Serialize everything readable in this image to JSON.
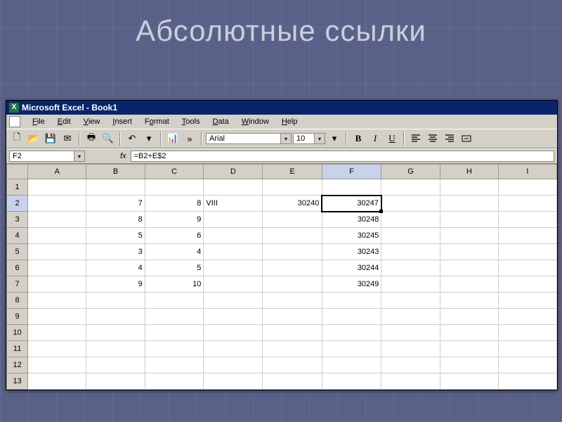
{
  "slide": {
    "title": "Абсолютные ссылки"
  },
  "window": {
    "title": "Microsoft Excel - Book1"
  },
  "menubar": {
    "items": [
      "File",
      "Edit",
      "View",
      "Insert",
      "Format",
      "Tools",
      "Data",
      "Window",
      "Help"
    ]
  },
  "toolbar": {
    "font_name": "Arial",
    "font_size": "10",
    "bold": "B",
    "italic": "I",
    "underline": "U"
  },
  "formula_bar": {
    "name_box": "F2",
    "fx_label": "fx",
    "formula": "=B2+E$2"
  },
  "sheet": {
    "columns": [
      "A",
      "B",
      "C",
      "D",
      "E",
      "F",
      "G",
      "H",
      "I"
    ],
    "active_col": "F",
    "active_row": "2",
    "rows": [
      {
        "num": "1",
        "cells": {
          "B": "",
          "C": "",
          "D": "",
          "E": "",
          "F": ""
        }
      },
      {
        "num": "2",
        "cells": {
          "B": "7",
          "C": "8",
          "D": "VIII",
          "E": "30240",
          "F": "30247"
        }
      },
      {
        "num": "3",
        "cells": {
          "B": "8",
          "C": "9",
          "D": "",
          "E": "",
          "F": "30248"
        }
      },
      {
        "num": "4",
        "cells": {
          "B": "5",
          "C": "6",
          "D": "",
          "E": "",
          "F": "30245"
        }
      },
      {
        "num": "5",
        "cells": {
          "B": "3",
          "C": "4",
          "D": "",
          "E": "",
          "F": "30243"
        }
      },
      {
        "num": "6",
        "cells": {
          "B": "4",
          "C": "5",
          "D": "",
          "E": "",
          "F": "30244"
        }
      },
      {
        "num": "7",
        "cells": {
          "B": "9",
          "C": "10",
          "D": "",
          "E": "",
          "F": "30249"
        }
      },
      {
        "num": "8",
        "cells": {
          "B": "",
          "C": "",
          "D": "",
          "E": "",
          "F": ""
        }
      },
      {
        "num": "9",
        "cells": {
          "B": "",
          "C": "",
          "D": "",
          "E": "",
          "F": ""
        }
      },
      {
        "num": "10",
        "cells": {
          "B": "",
          "C": "",
          "D": "",
          "E": "",
          "F": ""
        }
      },
      {
        "num": "11",
        "cells": {
          "B": "",
          "C": "",
          "D": "",
          "E": "",
          "F": ""
        }
      },
      {
        "num": "12",
        "cells": {
          "B": "",
          "C": "",
          "D": "",
          "E": "",
          "F": ""
        }
      },
      {
        "num": "13",
        "cells": {
          "B": "",
          "C": "",
          "D": "",
          "E": "",
          "F": ""
        }
      }
    ]
  }
}
